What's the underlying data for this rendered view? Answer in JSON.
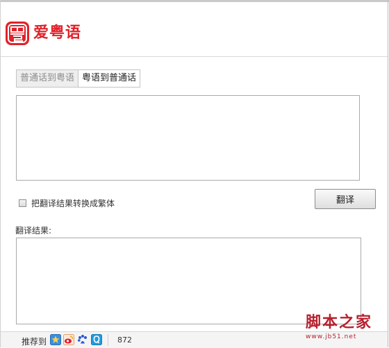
{
  "app": {
    "title": "爱粤语"
  },
  "tabs": [
    {
      "label": "普通话到粤语",
      "active": false
    },
    {
      "label": "粤语到普通话",
      "active": true
    }
  ],
  "source": {
    "value": ""
  },
  "options": {
    "traditional_label": "把翻译结果转换成繁体",
    "traditional_checked": false
  },
  "actions": {
    "translate_label": "翻译"
  },
  "result": {
    "label": "翻译结果:",
    "value": ""
  },
  "footer": {
    "recommend_label": "推荐到",
    "share_icons": [
      "qzone-icon",
      "weibo-icon",
      "baidu-icon",
      "qq-icon"
    ],
    "count": "872"
  },
  "watermark": {
    "title": "脚本之家",
    "url": "www.jb51.net"
  },
  "colors": {
    "brand_red": "#e0222a",
    "watermark_red": "#b8202e"
  }
}
